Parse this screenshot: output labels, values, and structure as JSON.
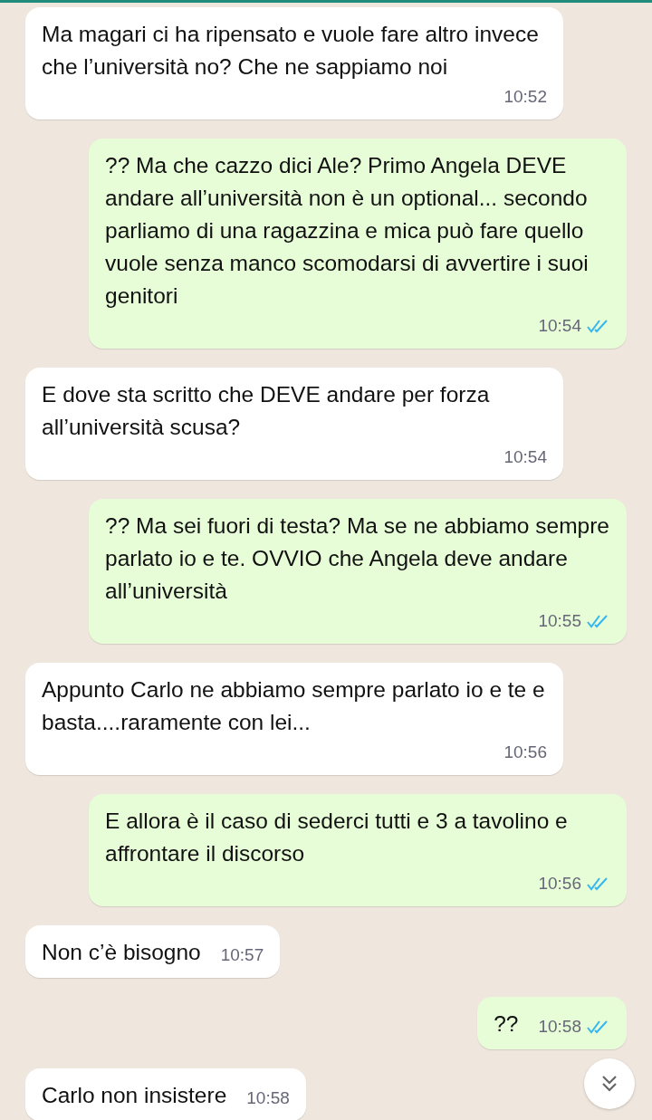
{
  "messages": [
    {
      "text": "Ma magari ci ha ripensato e vuole fare altro invece che l’università no? Che ne sappiamo noi",
      "time": "10:52",
      "outgoing": false
    },
    {
      "text": "?? Ma che cazzo dici Ale? Primo Angela DEVE andare all’università non è un optional... secondo parliamo di una ragazzina e mica può fare quello vuole senza manco scomodarsi di avvertire i suoi genitori",
      "time": "10:54",
      "outgoing": true,
      "read": true
    },
    {
      "text": "E dove sta scritto che DEVE andare per forza all’università scusa?",
      "time": "10:54",
      "outgoing": false
    },
    {
      "text": "?? Ma sei fuori di testa? Ma se ne abbiamo sempre parlato io e te. OVVIO che Angela deve andare all’università",
      "time": "10:55",
      "outgoing": true,
      "read": true
    },
    {
      "text": "Appunto Carlo ne abbiamo sempre parlato io e te e basta....raramente con lei...",
      "time": "10:56",
      "outgoing": false
    },
    {
      "text": "E allora è il caso di sederci tutti e 3 a tavolino e affrontare il discorso",
      "time": "10:56",
      "outgoing": true,
      "read": true
    },
    {
      "text": "Non c’è bisogno",
      "time": "10:57",
      "outgoing": false
    },
    {
      "text": "??",
      "time": "10:58",
      "outgoing": true,
      "read": true
    },
    {
      "text": "Carlo non insistere",
      "time": "10:58",
      "outgoing": false
    }
  ]
}
